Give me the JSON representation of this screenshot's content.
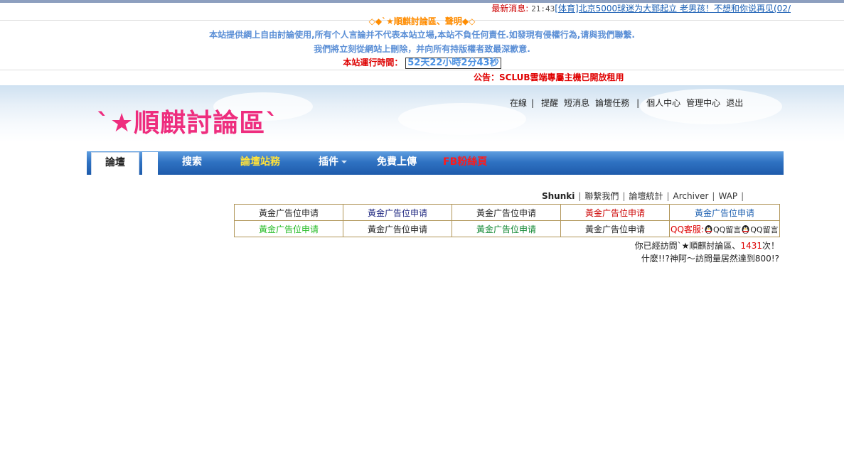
{
  "news": {
    "label": "最新消息:",
    "time": "21:43",
    "headline": "[体育]北京5000球迷为大郅起立  老男孩！不想和你说再见(02/"
  },
  "announcement": {
    "title": "◇◆`★順麒討論區、聲明◆◇",
    "disclaimer_line1": "本站提供網上自由討論使用,所有个人言論并不代表本站立場,本站不負任何責任.如發現有侵權行為,请與我們聯繫.",
    "disclaimer_line2": "我們將立刻從網站上刪除，并向所有持版權者致最深歉意.",
    "runtime_label": "本站運行時間：",
    "runtime_value": "52天22小時2分43秒",
    "notice": "公告：SCLUB雲端專屬主機已開放租用"
  },
  "toplinks": {
    "online": "在線",
    "remind": "提醒",
    "messages": "短消息",
    "tasks": "論壇任務",
    "profile": "個人中心",
    "admin": "管理中心",
    "logout": "退出"
  },
  "logo": {
    "text": "`★順麒討論區`"
  },
  "nav": {
    "forum": "論壇",
    "search": "搜索",
    "affairs": "論壇站務",
    "plugins": "插件",
    "upload": "免費上傳",
    "fb": "FB粉絲頁"
  },
  "sublinks": {
    "user": "Shunki",
    "contact": "聯繫我們",
    "stats": "論壇統計",
    "archiver": "Archiver",
    "wap": "WAP"
  },
  "ads": {
    "rows": [
      [
        {
          "text": "黃金广告位申请",
          "color": "#222222"
        },
        {
          "text": "黃金广告位申请",
          "color": "#1a237e"
        },
        {
          "text": "黃金广告位申请",
          "color": "#222222"
        },
        {
          "text": "黃金广告位申请",
          "color": "#cc0000"
        },
        {
          "text": "黃金广告位申请",
          "color": "#1c5fb0"
        }
      ],
      [
        {
          "text": "黃金广告位申请",
          "color": "#22bb22"
        },
        {
          "text": "黃金广告位申请",
          "color": "#222222"
        },
        {
          "text": "黃金广告位申请",
          "color": "#118833"
        },
        {
          "text": "黃金广告位申请",
          "color": "#222222"
        }
      ]
    ],
    "qq_label": "QQ客服:",
    "qq_msg1": "QQ留言",
    "qq_msg2": "QQ留言"
  },
  "visits": {
    "prefix": "你已經訪問`★順麒討論區、",
    "count": "1431",
    "suffix": "次！",
    "line2": "什麽!!?神阿～訪問量居然達到800!?"
  }
}
